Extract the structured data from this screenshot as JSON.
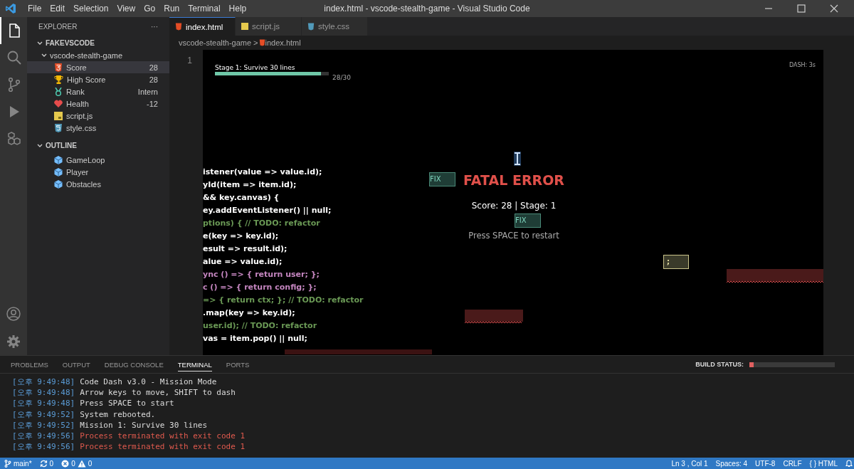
{
  "window": {
    "title": "index.html - vscode-stealth-game - Visual Studio Code"
  },
  "menu": [
    "File",
    "Edit",
    "Selection",
    "View",
    "Go",
    "Run",
    "Terminal",
    "Help"
  ],
  "activity_bar": [
    {
      "kind": "files",
      "selected": true
    },
    {
      "kind": "search",
      "selected": false
    },
    {
      "kind": "source-control",
      "selected": false
    },
    {
      "kind": "run",
      "selected": false
    },
    {
      "kind": "extensions",
      "selected": false
    }
  ],
  "explorer": {
    "title": "EXPLORER",
    "more": "···",
    "root": {
      "label": "FAKEVSCODE",
      "expanded": true,
      "children": [
        {
          "label": "vscode-stealth-game",
          "expanded": true,
          "children": [
            {
              "label": "Score",
              "value": "28",
              "kind": "html",
              "selected": true
            },
            {
              "label": "High Score",
              "value": "28",
              "kind": "trophy",
              "selected": false
            },
            {
              "label": "Rank",
              "value": "Intern",
              "kind": "medal",
              "selected": false
            },
            {
              "label": "Health",
              "value": "-12",
              "kind": "heart",
              "selected": false
            },
            {
              "label": "script.js",
              "kind": "js",
              "selected": false
            },
            {
              "label": "style.css",
              "kind": "css",
              "selected": false
            }
          ]
        }
      ]
    },
    "outline": {
      "label": "OUTLINE",
      "expanded": true,
      "items": [
        "GameLoop",
        "Player",
        "Obstacles"
      ]
    }
  },
  "tabs": [
    {
      "label": "index.html",
      "kind": "html",
      "selected": true
    },
    {
      "label": "script.js",
      "kind": "js",
      "selected": false
    },
    {
      "label": "style.css",
      "kind": "css",
      "selected": false
    }
  ],
  "breadcrumb": {
    "folder": "vscode-stealth-game",
    "separator": ">",
    "file": "index.html"
  },
  "line_numbers": [
    "1"
  ],
  "game": {
    "stage_label": "Stage 1: Survive 30 lines",
    "progress": {
      "level": 0.93
    },
    "progress_text": "28/30",
    "dash": "DASH: 3s",
    "code_lines": [
      {
        "text": "istener(value => value.id);",
        "color": "#ffffff"
      },
      {
        "text": "yId(item => item.id);",
        "color": "#ffffff"
      },
      {
        "text": "&& key.canvas) {",
        "color": "#ffffff"
      },
      {
        "text": "ey.addEventListener() || null;",
        "color": "#ffffff"
      },
      {
        "text": "ptions) { // TODO: refactor",
        "color": "#6a9955"
      },
      {
        "text": "e(key => key.id);",
        "color": "#ffffff"
      },
      {
        "text": "esult => result.id);",
        "color": "#ffffff"
      },
      {
        "text": "alue => value.id);",
        "color": "#ffffff"
      },
      {
        "text": "ync () => { return user; };",
        "color": "#c586c0"
      },
      {
        "text": "c () => { return config; };",
        "color": "#c586c0"
      },
      {
        "text": "=> { return ctx; }; // TODO: refactor",
        "color": "#6a9955"
      },
      {
        "text": ".map(key => key.id);",
        "color": "#ffffff"
      },
      {
        "text": "user.id); // TODO: refactor",
        "color": "#6a9955"
      },
      {
        "text": "vas = item.pop() || null;",
        "color": "#ffffff"
      }
    ],
    "title": "FATAL ERROR",
    "score_text": "Score: 28 | Stage: 1",
    "restart": "Press SPACE to restart",
    "tokens": [
      {
        "text": "FIX",
        "kind": "fix"
      },
      {
        "text": "FIX",
        "kind": "fix"
      },
      {
        "text": ";",
        "kind": "semicolon"
      }
    ]
  },
  "panel": {
    "tabs": [
      {
        "label": "PROBLEMS",
        "selected": false
      },
      {
        "label": "OUTPUT",
        "selected": false
      },
      {
        "label": "DEBUG CONSOLE",
        "selected": false
      },
      {
        "label": "TERMINAL",
        "selected": true
      },
      {
        "label": "PORTS",
        "selected": false
      }
    ],
    "build_status": {
      "label": "BUILD STATUS:",
      "level": 0.05
    },
    "terminal": [
      {
        "time": "[오후 9:49:48]",
        "text": "Code Dash v3.0 - Mission Mode",
        "kind": "info"
      },
      {
        "time": "[오후 9:49:48]",
        "text": "Arrow keys to move, SHIFT to dash",
        "kind": "info"
      },
      {
        "time": "[오후 9:49:48]",
        "text": "Press SPACE to start",
        "kind": "info"
      },
      {
        "time": "[오후 9:49:52]",
        "text": "System rebooted.",
        "kind": "info"
      },
      {
        "time": "[오후 9:49:52]",
        "text": "Mission 1: Survive 30 lines",
        "kind": "info"
      },
      {
        "time": "[오후 9:49:56]",
        "text": "Process terminated with exit code 1",
        "kind": "error"
      },
      {
        "time": "[오후 9:49:56]",
        "text": "Process terminated with exit code 1",
        "kind": "error"
      }
    ]
  },
  "status_bar": {
    "branch": "main*",
    "sync": "0",
    "errors": "0",
    "warnings": "0",
    "right": [
      "Ln 3 , Col 1",
      "Spaces: 4",
      "UTF-8",
      "CRLF",
      "{ } HTML"
    ]
  }
}
